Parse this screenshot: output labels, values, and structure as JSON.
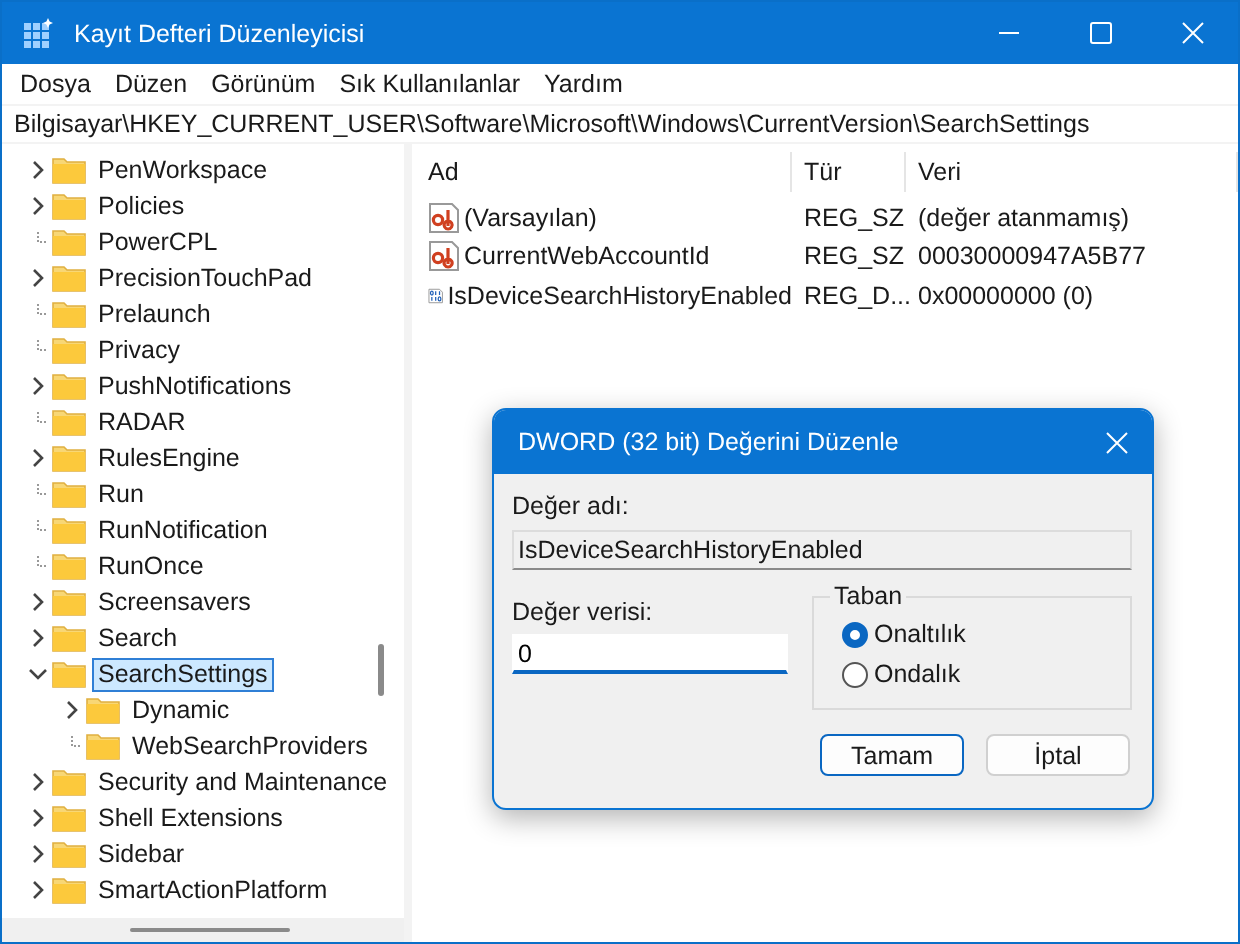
{
  "window": {
    "title": "Kayıt Defteri Düzenleyicisi"
  },
  "menu": [
    "Dosya",
    "Düzen",
    "Görünüm",
    "Sık Kullanılanlar",
    "Yardım"
  ],
  "address": "Bilgisayar\\HKEY_CURRENT_USER\\Software\\Microsoft\\Windows\\CurrentVersion\\SearchSettings",
  "tree": [
    {
      "label": "PenWorkspace",
      "kind": "node",
      "expanded": false,
      "selected": false
    },
    {
      "label": "Policies",
      "kind": "node",
      "expanded": false,
      "selected": false
    },
    {
      "label": "PowerCPL",
      "kind": "leaf",
      "selected": false
    },
    {
      "label": "PrecisionTouchPad",
      "kind": "node",
      "expanded": false,
      "selected": false
    },
    {
      "label": "Prelaunch",
      "kind": "leaf",
      "selected": false
    },
    {
      "label": "Privacy",
      "kind": "leaf",
      "selected": false
    },
    {
      "label": "PushNotifications",
      "kind": "node",
      "expanded": false,
      "selected": false
    },
    {
      "label": "RADAR",
      "kind": "leaf",
      "selected": false
    },
    {
      "label": "RulesEngine",
      "kind": "node",
      "expanded": false,
      "selected": false
    },
    {
      "label": "Run",
      "kind": "leaf",
      "selected": false
    },
    {
      "label": "RunNotification",
      "kind": "leaf",
      "selected": false
    },
    {
      "label": "RunOnce",
      "kind": "leaf",
      "selected": false
    },
    {
      "label": "Screensavers",
      "kind": "node",
      "expanded": false,
      "selected": false
    },
    {
      "label": "Search",
      "kind": "node",
      "expanded": false,
      "selected": false
    },
    {
      "label": "SearchSettings",
      "kind": "node",
      "expanded": true,
      "selected": true,
      "children": [
        {
          "label": "Dynamic",
          "kind": "node",
          "expanded": false,
          "selected": false
        },
        {
          "label": "WebSearchProviders",
          "kind": "leaf",
          "selected": false
        }
      ]
    },
    {
      "label": "Security and Maintenance",
      "kind": "node",
      "expanded": false,
      "selected": false
    },
    {
      "label": "Shell Extensions",
      "kind": "node",
      "expanded": false,
      "selected": false
    },
    {
      "label": "Sidebar",
      "kind": "node",
      "expanded": false,
      "selected": false
    },
    {
      "label": "SmartActionPlatform",
      "kind": "node",
      "expanded": false,
      "selected": false
    }
  ],
  "list": {
    "columns": [
      "Ad",
      "Tür",
      "Veri"
    ],
    "rows": [
      {
        "kind": "string",
        "name": "(Varsayılan)",
        "type": "REG_SZ",
        "data": "(değer atanmamış)"
      },
      {
        "kind": "string",
        "name": "CurrentWebAccountId",
        "type": "REG_SZ",
        "data": "00030000947A5B77"
      },
      {
        "kind": "binary",
        "name": "IsDeviceSearchHistoryEnabled",
        "type": "REG_D...",
        "data": "0x00000000 (0)"
      }
    ]
  },
  "dialog": {
    "title": "DWORD (32 bit) Değerini Düzenle",
    "name_label": "Değer adı:",
    "name_value": "IsDeviceSearchHistoryEnabled",
    "data_label": "Değer verisi:",
    "data_value": "0",
    "base_label": "Taban",
    "base_options": [
      {
        "label": "Onaltılık",
        "selected": true
      },
      {
        "label": "Ondalık",
        "selected": false
      }
    ],
    "buttons": [
      {
        "label": "Tamam",
        "default": true
      },
      {
        "label": "İptal",
        "default": false
      }
    ]
  }
}
